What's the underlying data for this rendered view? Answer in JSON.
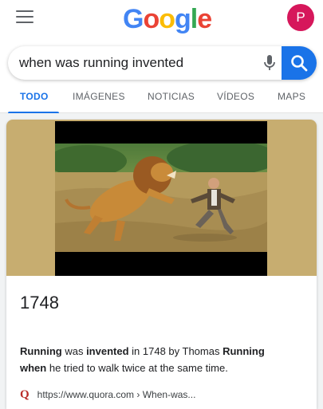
{
  "header": {
    "logo_letters": [
      "G",
      "o",
      "o",
      "g",
      "l",
      "e"
    ],
    "avatar_letter": "P",
    "avatar_color": "#d6175b"
  },
  "search": {
    "query": "when was running invented",
    "accent_color": "#1a73e8"
  },
  "tabs": [
    {
      "label": "TODO",
      "active": true
    },
    {
      "label": "IMÁGENES",
      "active": false
    },
    {
      "label": "NOTICIAS",
      "active": false
    },
    {
      "label": "VÍDEOS",
      "active": false
    },
    {
      "label": "MAPS",
      "active": false
    }
  ],
  "result": {
    "answer": "1748",
    "snippet_parts": [
      {
        "text": "Running",
        "bold": true
      },
      {
        "text": " was ",
        "bold": false
      },
      {
        "text": "invented",
        "bold": true
      },
      {
        "text": " in 1748 by Thomas ",
        "bold": false
      },
      {
        "text": "Running",
        "bold": true
      },
      {
        "text": " ",
        "bold": false
      },
      {
        "text": "when",
        "bold": true
      },
      {
        "text": " he tried to walk twice at the same time.",
        "bold": false
      }
    ],
    "source_icon": "quora-icon",
    "source_url": "https://www.quora.com › When-was..."
  }
}
